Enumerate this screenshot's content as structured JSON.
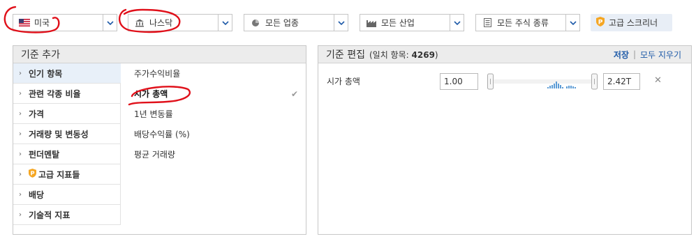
{
  "filters": {
    "country": {
      "label": "미국",
      "icon": "us-flag-icon"
    },
    "exchange": {
      "label": "나스닥",
      "icon": "bank-icon"
    },
    "sector": {
      "label": "모든 업종",
      "icon": "pie-chart-icon"
    },
    "industry": {
      "label": "모든 산업",
      "icon": "factory-icon"
    },
    "equity_type": {
      "label": "모든 주식 종류",
      "icon": "document-icon"
    },
    "premium_screener": {
      "label": "고급 스크리너",
      "icon": "premium-p-icon"
    }
  },
  "left_panel": {
    "title": "기준 추가",
    "categories": [
      {
        "label": "인기 항목",
        "active": true
      },
      {
        "label": "관련 각종 비율"
      },
      {
        "label": "가격"
      },
      {
        "label": "거래량 및 변동성"
      },
      {
        "label": "펀더멘탈"
      },
      {
        "label": "고급 지표들",
        "premium": true
      },
      {
        "label": "배당"
      },
      {
        "label": "기술적 지표"
      }
    ],
    "criteria": [
      {
        "label": "주가수익비율"
      },
      {
        "label": "시가 총액",
        "selected": true
      },
      {
        "label": "1년 변동률"
      },
      {
        "label": "배당수익률 (%)"
      },
      {
        "label": "평균 거래량"
      }
    ]
  },
  "right_panel": {
    "title": "기준 편집",
    "match_label": "(일치 항목:",
    "match_count": "4269",
    "match_close": ")",
    "save_label": "저장",
    "clear_label": "모두 지우기",
    "rows": [
      {
        "name": "시가 총액",
        "min": "1.00",
        "max": "2.42T"
      }
    ]
  },
  "colors": {
    "accent_blue": "#1e5aa8",
    "annotation_red": "#e0101a",
    "active_category_bg": "#e8f0f9",
    "premium_orange": "#f5a623"
  }
}
